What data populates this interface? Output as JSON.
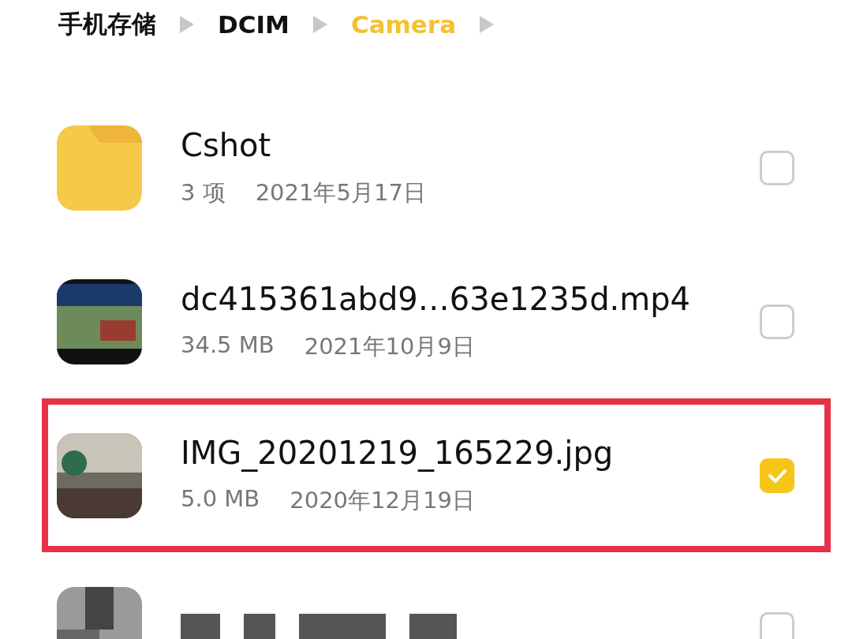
{
  "breadcrumb": [
    {
      "label": "手机存储",
      "selected": false
    },
    {
      "label": "DCIM",
      "selected": false
    },
    {
      "label": "Camera",
      "selected": true
    }
  ],
  "files": [
    {
      "kind": "folder",
      "name": "Cshot",
      "size": "3 项",
      "date": "2021年5月17日",
      "checked": false,
      "highlighted": false
    },
    {
      "kind": "video",
      "name": "dc415361abd9…63e1235d.mp4",
      "size": "34.5 MB",
      "date": "2021年10月9日",
      "checked": false,
      "highlighted": false
    },
    {
      "kind": "image",
      "name": "IMG_20201219_165229.jpg",
      "size": "5.0 MB",
      "date": "2020年12月19日",
      "checked": true,
      "highlighted": true
    },
    {
      "kind": "pixelated",
      "checked": false,
      "highlighted": false
    }
  ]
}
